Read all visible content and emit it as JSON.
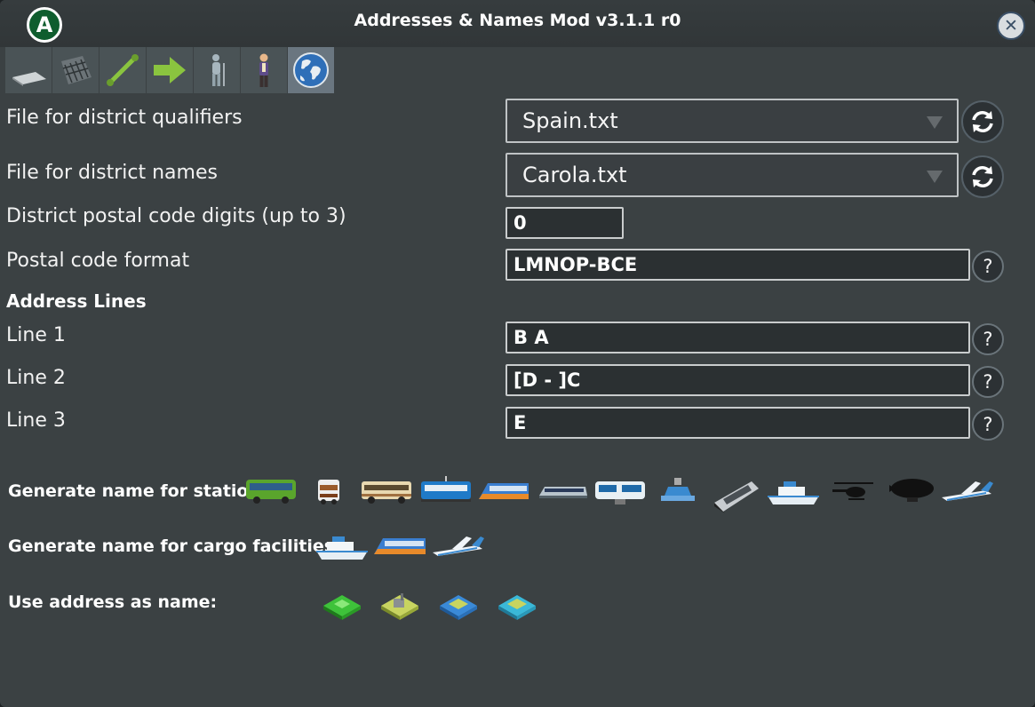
{
  "window": {
    "title": "Addresses & Names Mod v3.1.1 r0",
    "logo_letter": "A",
    "close_glyph": "✕"
  },
  "tabs": [
    {
      "icon": "road-tab-icon"
    },
    {
      "icon": "building-tab-icon"
    },
    {
      "icon": "segment-tab-icon"
    },
    {
      "icon": "arrow-tab-icon"
    },
    {
      "icon": "citizen-tab-icon"
    },
    {
      "icon": "person-tab-icon"
    },
    {
      "icon": "globe-tab-icon",
      "active": true
    }
  ],
  "settings": {
    "district_qualifiers": {
      "label": "File for district qualifiers",
      "value": "Spain.txt"
    },
    "district_names": {
      "label": "File for district names",
      "value": "Carola.txt"
    },
    "postal_digits": {
      "label": "District postal code digits (up to 3)",
      "value": "0"
    },
    "postal_format": {
      "label": "Postal code format",
      "value": "LMNOP-BCE"
    }
  },
  "address_lines": {
    "title": "Address Lines",
    "lines": [
      {
        "label": "Line 1",
        "value": "B A"
      },
      {
        "label": "Line 2",
        "value": "[D - ]C"
      },
      {
        "label": "Line 3",
        "value": "E"
      }
    ]
  },
  "help_glyph": "?",
  "stations": {
    "label": "Generate name for stations:",
    "icons": [
      "bus-icon",
      "trolleybus-icon",
      "intercity-bus-icon",
      "tram-icon",
      "train-icon",
      "metro-icon",
      "monorail-icon",
      "cable-car-icon",
      "ferry-icon",
      "ship-icon",
      "helicopter-icon",
      "blimp-icon",
      "airplane-icon"
    ]
  },
  "cargo": {
    "label": "Generate name for cargo facilities:",
    "icons": [
      "cargo-ship-icon",
      "cargo-train-icon",
      "cargo-airplane-icon"
    ]
  },
  "address_as_name": {
    "label": "Use address as name:",
    "icons": [
      "residential-zone-icon",
      "industrial-zone-icon",
      "commercial-zone-icon",
      "office-zone-icon"
    ]
  },
  "colors": {
    "panel": "#3b4143",
    "titlebar": "#343a3c",
    "accent_green": "#8ac43f",
    "input_bg": "#2b3032"
  }
}
